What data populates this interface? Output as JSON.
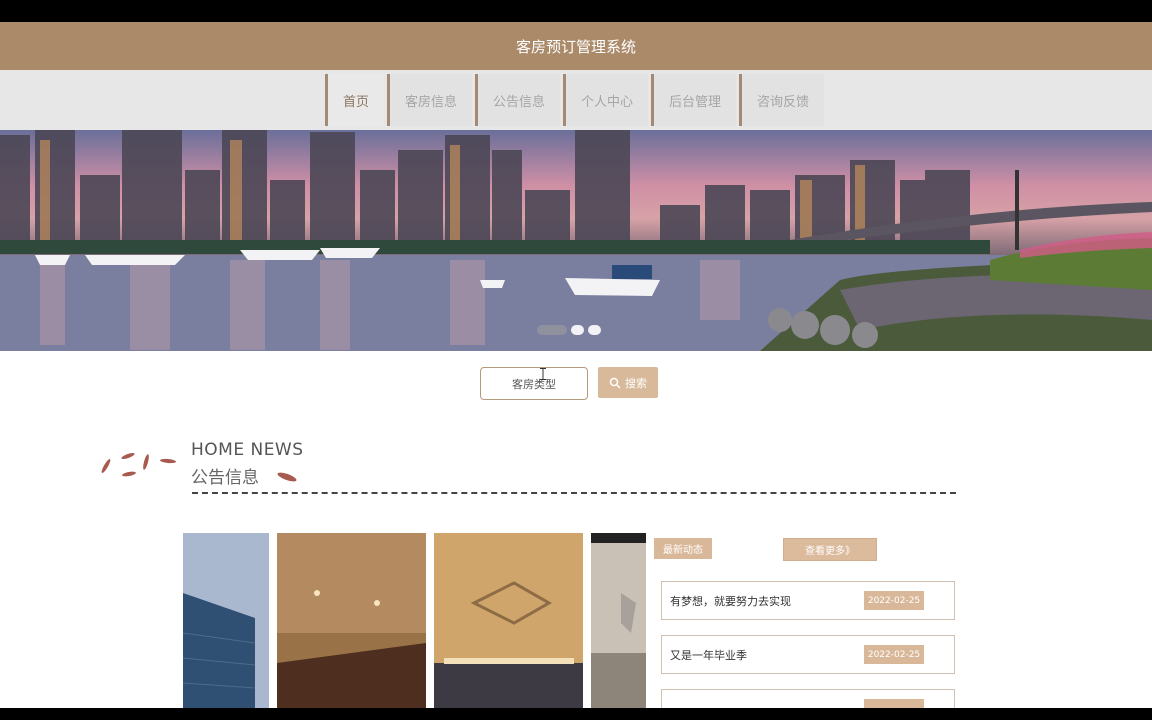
{
  "app": {
    "title": "客房预订管理系统"
  },
  "nav": {
    "items": [
      {
        "label": "首页",
        "active": true
      },
      {
        "label": "客房信息"
      },
      {
        "label": "公告信息"
      },
      {
        "label": "个人中心"
      },
      {
        "label": "后台管理"
      },
      {
        "label": "咨询反馈"
      }
    ]
  },
  "carousel": {
    "slide_count": 3,
    "current_slide": 1
  },
  "search": {
    "input_value": "客房类型",
    "button_label": "搜索"
  },
  "news_section": {
    "heading_en": "HOME NEWS",
    "heading_zh": "公告信息",
    "latest_tag": "最新动态",
    "more_label": "查看更多》",
    "items": [
      {
        "title": "有梦想，就要努力去实现",
        "date": "2022-02-25"
      },
      {
        "title": "又是一年毕业季",
        "date": "2022-02-25"
      },
      {
        "title": "",
        "date": ""
      }
    ]
  },
  "colors": {
    "brand": "#ab8a6a",
    "accent": "#d9b89a",
    "nav_bg": "#e7e7e7"
  }
}
